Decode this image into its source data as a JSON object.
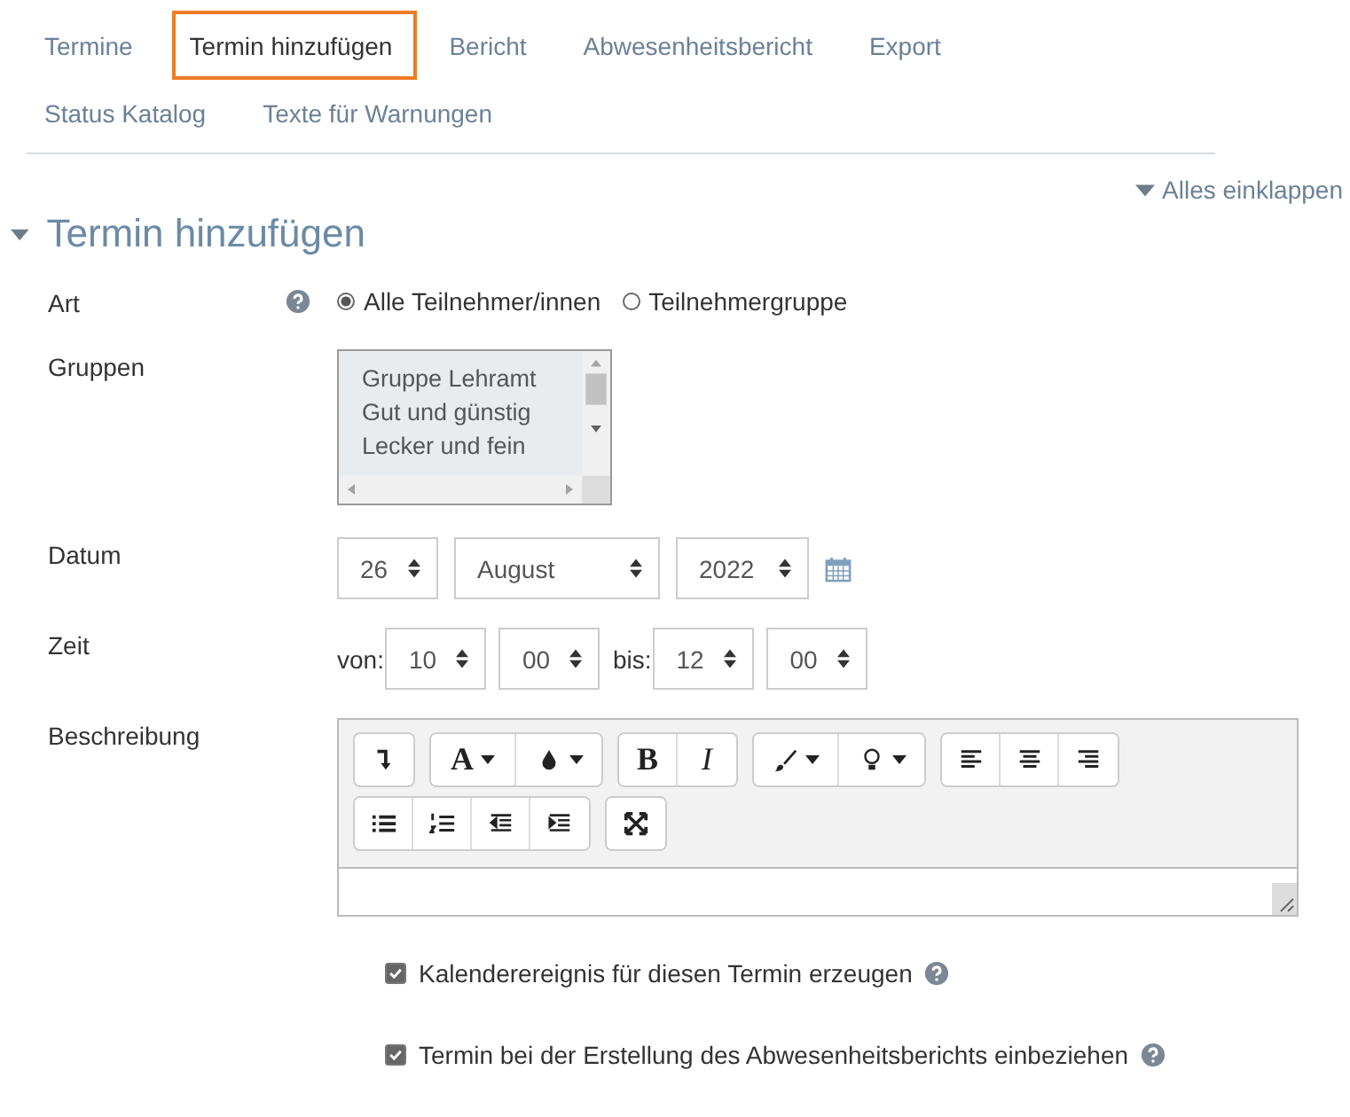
{
  "tab_rows": [
    {
      "tabs": [
        {
          "label": "Termine",
          "selected": false
        },
        {
          "label": "Termin hinzufügen",
          "selected": true
        },
        {
          "label": "Bericht",
          "selected": false
        },
        {
          "label": "Abwesenheitsbericht",
          "selected": false
        },
        {
          "label": "Export",
          "selected": false
        }
      ]
    },
    {
      "tabs": [
        {
          "label": "Status Katalog",
          "selected": false
        },
        {
          "label": "Texte für Warnungen",
          "selected": false
        }
      ]
    }
  ],
  "collapse_all": "Alles einklappen",
  "section": {
    "title": "Termin hinzufügen",
    "expanded": true
  },
  "fields": [
    {
      "kind": "radio",
      "label": "Art",
      "help": true,
      "options": [
        {
          "label": "Alle Teilnehmer/innen",
          "selected": true
        },
        {
          "label": "Teilnehmergruppe",
          "selected": false
        }
      ]
    },
    {
      "kind": "listbox",
      "label": "Gruppen",
      "help": false,
      "disabled": true,
      "items": [
        "Gruppe Lehramt",
        "Gut und günstig",
        "Lecker und fein"
      ]
    },
    {
      "kind": "date",
      "label": "Datum",
      "help": false,
      "selects": [
        "26",
        "August",
        "2022"
      ]
    },
    {
      "kind": "time",
      "label": "Zeit",
      "help": false,
      "from_label": "von:",
      "from": [
        "10",
        "00"
      ],
      "to_label": "bis:",
      "to": [
        "12",
        "00"
      ]
    },
    {
      "kind": "editor",
      "label": "Beschreibung",
      "help": false,
      "toolbar_rows": [
        [
          {
            "buttons": [
              {
                "kind": "redo"
              }
            ]
          },
          {
            "buttons": [
              {
                "kind": "text",
                "label": "A",
                "caret": true
              },
              {
                "kind": "drop",
                "caret": true
              }
            ]
          },
          {
            "buttons": [
              {
                "kind": "text",
                "label": "B",
                "caret": false
              },
              {
                "kind": "text-italic",
                "label": "I",
                "caret": false
              }
            ]
          },
          {
            "buttons": [
              {
                "kind": "brush",
                "caret": true
              },
              {
                "kind": "bulb",
                "caret": true
              }
            ]
          },
          {
            "buttons": [
              {
                "kind": "align-left"
              },
              {
                "kind": "align-center"
              },
              {
                "kind": "align-right"
              }
            ]
          }
        ],
        [
          {
            "buttons": [
              {
                "kind": "list-bullet"
              },
              {
                "kind": "list-number"
              },
              {
                "kind": "outdent"
              },
              {
                "kind": "indent"
              }
            ]
          },
          {
            "buttons": [
              {
                "kind": "fullscreen"
              }
            ]
          }
        ]
      ]
    }
  ],
  "checkboxes": [
    {
      "label": "Kalenderereignis für diesen Termin erzeugen",
      "checked": true,
      "help": true
    },
    {
      "label": "Termin bei der Erstellung des Abwesenheitsberichts einbeziehen",
      "checked": true,
      "help": true
    }
  ]
}
